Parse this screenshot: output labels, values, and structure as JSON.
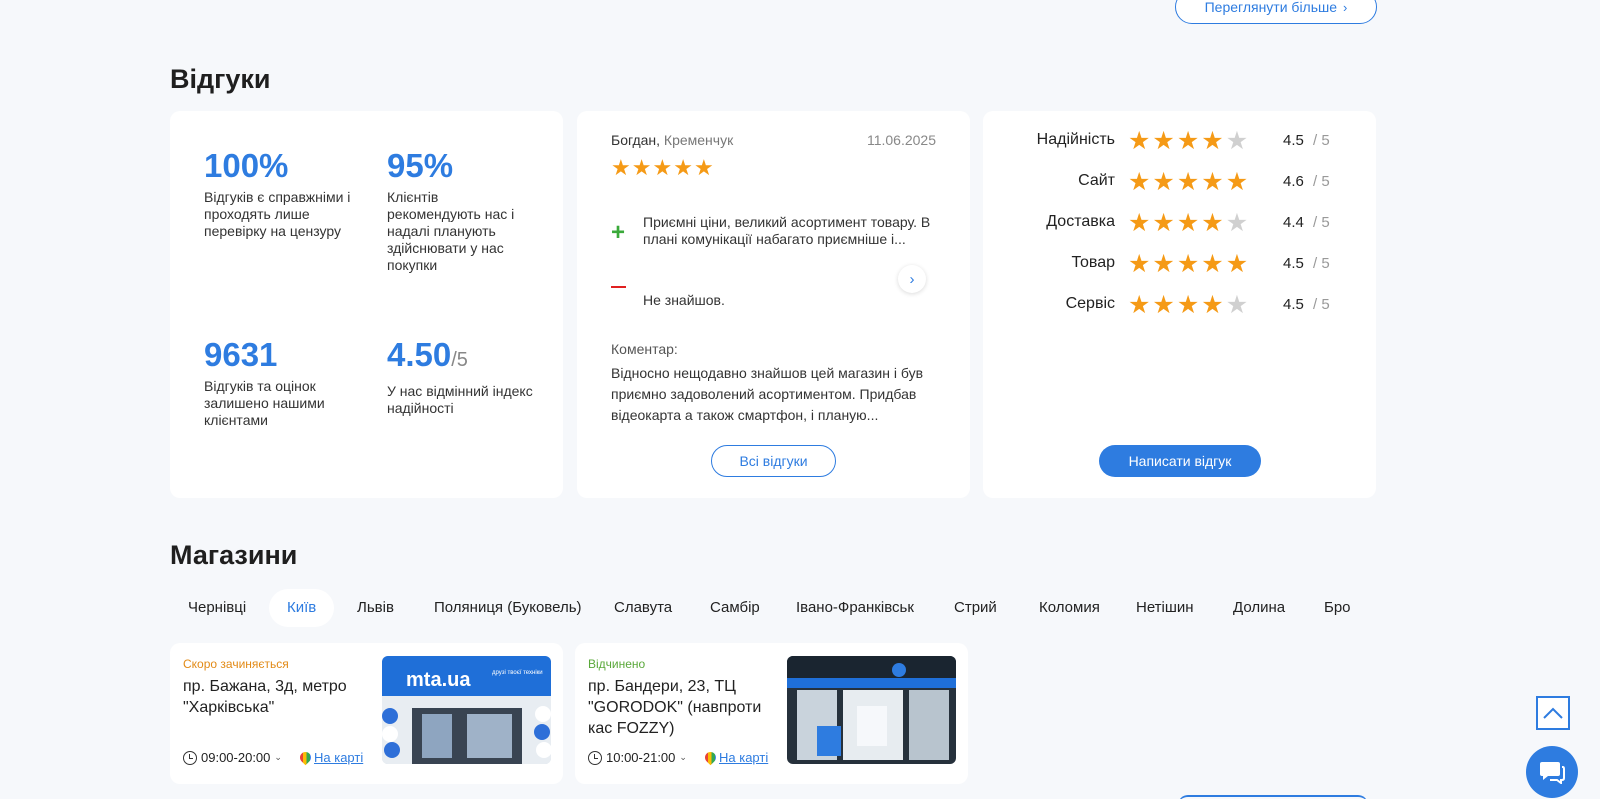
{
  "top": {
    "more_label": "Переглянути більше"
  },
  "reviews": {
    "title": "Відгуки",
    "stats": [
      {
        "value": "100%",
        "desc": "Відгуків є справжніми і проходять лише перевірку на цензуру"
      },
      {
        "value": "95%",
        "desc": "Клієнтів рекомендують нас і надалі планують здійснювати у нас покупки"
      },
      {
        "value": "9631",
        "desc": "Відгуків та оцінок залишено нашими клієнтами"
      },
      {
        "value": "4.50",
        "suffix": "/5",
        "desc": "У нас відмінний індекс надійності"
      }
    ],
    "featured": {
      "author": "Богдан,",
      "city": "Кременчук",
      "date": "11.06.2025",
      "stars": 5,
      "pro": "Приємні ціни, великий асортимент товару. В плані комунікації набагато приємніше і...",
      "con": "Не знайшов.",
      "comment_label": "Коментар:",
      "comment": "Відносно нещодавно знайшов цей магазин і був приємно задоволений асортиментом. Придбав відеокарта а також смартфон, і планую..."
    },
    "all_label": "Всі відгуки",
    "ratings": [
      {
        "label": "Надійність",
        "value": "4.5",
        "max": "/ 5",
        "stars": 4
      },
      {
        "label": "Сайт",
        "value": "4.6",
        "max": "/ 5",
        "stars": 5
      },
      {
        "label": "Доставка",
        "value": "4.4",
        "max": "/ 5",
        "stars": 4
      },
      {
        "label": "Товар",
        "value": "4.5",
        "max": "/ 5",
        "stars": 5
      },
      {
        "label": "Сервіс",
        "value": "4.5",
        "max": "/ 5",
        "stars": 4
      }
    ],
    "write_label": "Написати відгук"
  },
  "shops": {
    "title": "Магазини",
    "cities": [
      "Чернівці",
      "Київ",
      "Львів",
      "Поляниця (Буковель)",
      "Славута",
      "Самбір",
      "Івано-Франківськ",
      "Стрий",
      "Коломия",
      "Нетішин",
      "Долина",
      "Бро"
    ],
    "active_city": "Київ",
    "stores": [
      {
        "status": "Скоро зачиняється",
        "address": "пр. Бажана, 3д, метро \"Харківська\"",
        "hours": "09:00-20:00",
        "map_label": "На карті",
        "sign_text": "mta.ua",
        "sign_sub": "друзі твоєї техніки"
      },
      {
        "status": "Відчинено",
        "address": "пр. Бандери, 23, ТЦ \"GORODOK\" (навпроти кас FOZZY)",
        "hours": "10:00-21:00",
        "map_label": "На карті"
      }
    ]
  },
  "colors": {
    "accent": "#2e7ce0",
    "star": "#f59a16",
    "star_off": "#d0d0d0",
    "soon": "#e28a16",
    "open": "#5aa83a"
  },
  "icons": [
    "chevron-right-icon",
    "plus-icon",
    "minus-icon",
    "clock-icon",
    "map-pin-icon",
    "arrow-up-icon",
    "chat-icon"
  ]
}
